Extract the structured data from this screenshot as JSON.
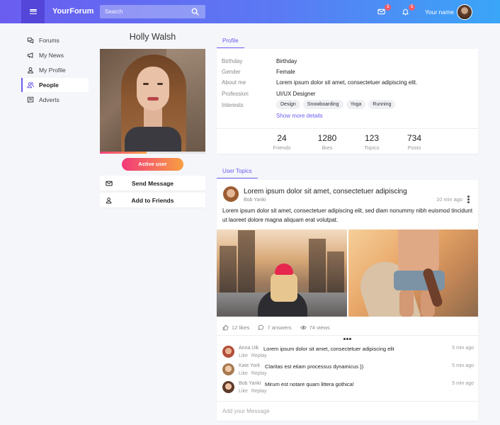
{
  "header": {
    "brand": "YourForum",
    "search_placeholder": "Search",
    "messages_badge": "3",
    "notifications_badge": "5",
    "username": "Your name",
    "gradient_colors": [
      "#6a5df0",
      "#3aa6f8"
    ]
  },
  "sidebar": {
    "items": [
      {
        "label": "Forums",
        "icon": "forums-icon"
      },
      {
        "label": "My News",
        "icon": "megaphone-icon"
      },
      {
        "label": "My Profile",
        "icon": "user-icon"
      },
      {
        "label": "People",
        "icon": "people-icon",
        "active": true
      },
      {
        "label": "Adverts",
        "icon": "adverts-icon"
      }
    ]
  },
  "profile": {
    "name": "Holly Walsh",
    "status": "Active user",
    "progress": 0.44,
    "send_message": "Send Message",
    "add_friends": "Add to Friends"
  },
  "tabs": {
    "profile": "Profile",
    "topics": "User Topics"
  },
  "info": {
    "birthday_label": "Birthday",
    "birthday_value": "Birthday",
    "gender_label": "Gender",
    "gender_value": "Female",
    "about_label": "About me",
    "about_value": "Lorem ipsum dolor sit amet, consectetuer adipiscing elit.",
    "profession_label": "Profession",
    "profession_value": "UI/UX Designer",
    "interests_label": "Interests",
    "interests": [
      "Design",
      "Snowboarding",
      "Yoga",
      "Running"
    ],
    "show_more": "Show more details"
  },
  "stats": [
    {
      "value": "24",
      "label": "Friends"
    },
    {
      "value": "1280",
      "label": "likes"
    },
    {
      "value": "123",
      "label": "Topics"
    },
    {
      "value": "734",
      "label": "Posts"
    }
  ],
  "post": {
    "title": "Lorem ipsum dolor sit amet, consectetuer adipiscing",
    "author": "Bob Yanki",
    "time": "10 min ago",
    "body": "Lorem ipsum dolor sit amet, consectetuer adipiscing elit, sed diam nonummy nibh euismod tincidunt ut laoreet dolore magna aliquam erat volutpat.",
    "likes": "12 likes",
    "answers": "7 answers",
    "views": "74 views"
  },
  "comments": [
    {
      "author": "Anna Uik",
      "text": "Lorem ipsum dolor sit amet, consectetuer adipiscing elit",
      "time": "5 min ago",
      "like": "Like",
      "reply": "Replay"
    },
    {
      "author": "Kate York",
      "text": "Claritas est etiam processus dynamicus })",
      "time": "5 min ago",
      "like": "Like",
      "reply": "Replay"
    },
    {
      "author": "Bob Yanki",
      "text": "Mirum est notare quam littera gothica!",
      "time": "5 min ago",
      "like": "Like",
      "reply": "Replay"
    }
  ],
  "message_placeholder": "Add your Message"
}
